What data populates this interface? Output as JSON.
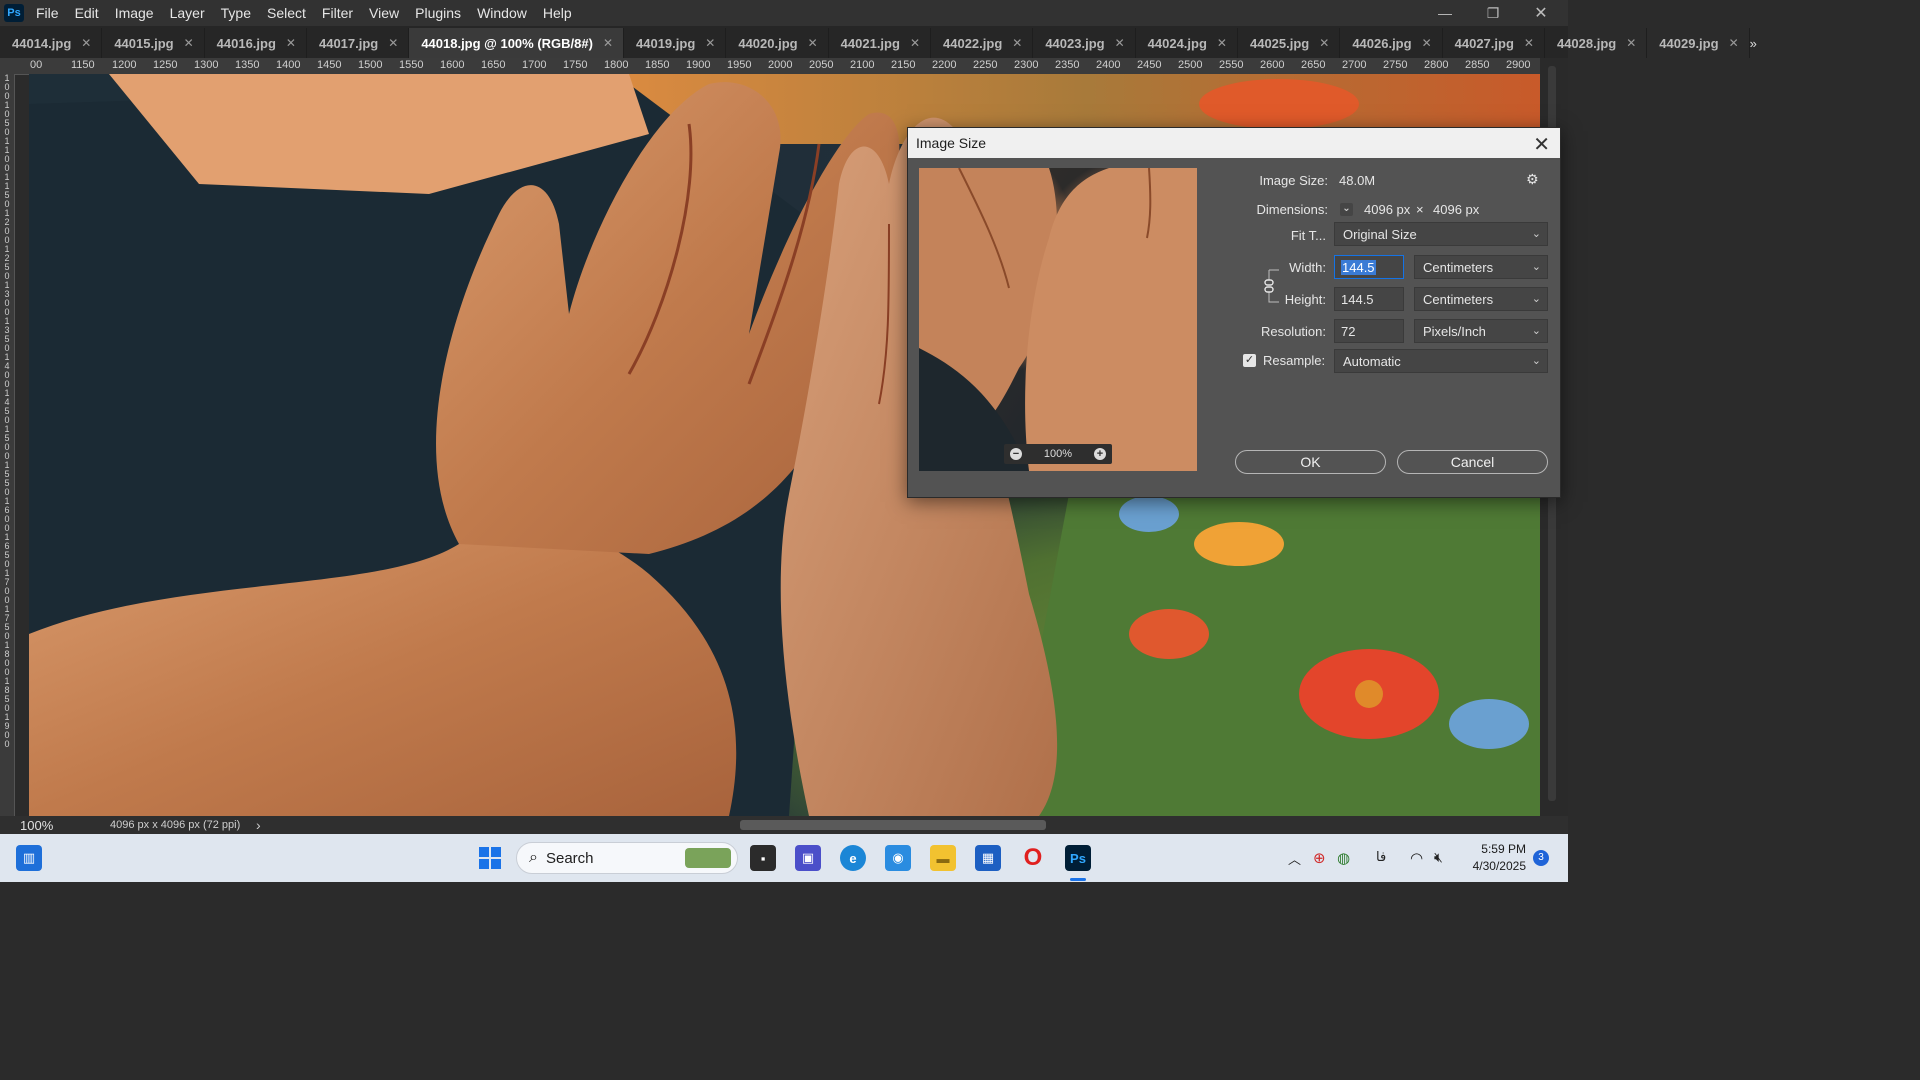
{
  "menu": [
    "File",
    "Edit",
    "Image",
    "Layer",
    "Type",
    "Select",
    "Filter",
    "View",
    "Plugins",
    "Window",
    "Help"
  ],
  "app_logo": "Ps",
  "tabs": [
    {
      "label": "44014.jpg",
      "active": false
    },
    {
      "label": "44015.jpg",
      "active": false
    },
    {
      "label": "44016.jpg",
      "active": false
    },
    {
      "label": "44017.jpg",
      "active": false
    },
    {
      "label": "44018.jpg @ 100% (RGB/8#)",
      "active": true
    },
    {
      "label": "44019.jpg",
      "active": false
    },
    {
      "label": "44020.jpg",
      "active": false
    },
    {
      "label": "44021.jpg",
      "active": false
    },
    {
      "label": "44022.jpg",
      "active": false
    },
    {
      "label": "44023.jpg",
      "active": false
    },
    {
      "label": "44024.jpg",
      "active": false
    },
    {
      "label": "44025.jpg",
      "active": false
    },
    {
      "label": "44026.jpg",
      "active": false
    },
    {
      "label": "44027.jpg",
      "active": false
    },
    {
      "label": "44028.jpg",
      "active": false
    },
    {
      "label": "44029.jpg",
      "active": false
    }
  ],
  "ruler_h": [
    "00",
    "1150",
    "1200",
    "1250",
    "1300",
    "1350",
    "1400",
    "1450",
    "1500",
    "1550",
    "1600",
    "1650",
    "1700",
    "1750",
    "1800",
    "1850",
    "1900",
    "1950",
    "2000",
    "2050",
    "2100",
    "2150",
    "2200",
    "2250",
    "2300",
    "2350",
    "2400",
    "2450",
    "2500",
    "2550",
    "2600",
    "2650",
    "2700",
    "2750",
    "2800",
    "2850",
    "2900",
    "295"
  ],
  "ruler_v": [
    "1",
    "0",
    "0",
    "1",
    "0",
    "5",
    "0",
    "1",
    "1",
    "0",
    "0",
    "1",
    "1",
    "5",
    "0",
    "1",
    "2",
    "0",
    "0",
    "1",
    "2",
    "5",
    "0",
    "1",
    "3",
    "0",
    "0",
    "1",
    "3",
    "5",
    "0",
    "1",
    "4",
    "0",
    "0",
    "1",
    "4",
    "5",
    "0",
    "1",
    "5",
    "0",
    "0",
    "1",
    "5",
    "5",
    "0",
    "1",
    "6",
    "0",
    "0",
    "1",
    "6",
    "5",
    "0",
    "1",
    "7",
    "0",
    "0",
    "1",
    "7",
    "5",
    "0",
    "1",
    "8",
    "0",
    "0",
    "1",
    "8",
    "5",
    "0",
    "1",
    "9",
    "0",
    "0"
  ],
  "status": {
    "zoom": "100%",
    "doc_info": "4096 px x 4096 px (72 ppi)",
    "arrow": "›"
  },
  "dialog": {
    "title": "Image Size",
    "image_size_label": "Image Size:",
    "image_size_value": "48.0M",
    "dimensions_label": "Dimensions:",
    "dim_w": "4096 px",
    "dim_x": "×",
    "dim_h": "4096 px",
    "fit_label": "Fit T...",
    "fit_value": "Original Size",
    "width_label": "Width:",
    "width_value": "144.5",
    "width_unit": "Centimeters",
    "height_label": "Height:",
    "height_value": "144.5",
    "height_unit": "Centimeters",
    "resolution_label": "Resolution:",
    "resolution_value": "72",
    "resolution_unit": "Pixels/Inch",
    "resample_label": "Resample:",
    "resample_checked": true,
    "resample_value": "Automatic",
    "preview_zoom": "100%",
    "ok": "OK",
    "cancel": "Cancel"
  },
  "taskbar": {
    "search_label": "Search",
    "time": "5:59 PM",
    "date": "4/30/2025",
    "lang": "فا",
    "notifications": "3"
  },
  "colors": {
    "accent": "#1473e6",
    "ps_blue": "#31a8ff",
    "dialog_bg": "#535353"
  }
}
